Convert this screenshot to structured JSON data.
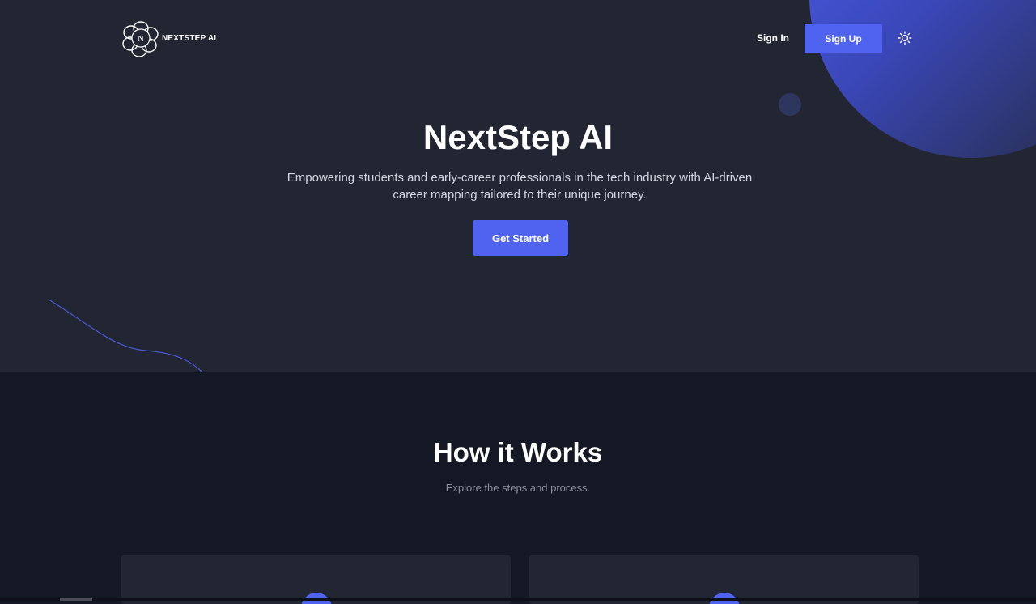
{
  "header": {
    "logo_text": "NEXTSTEP AI",
    "logo_letter": "N",
    "sign_in_label": "Sign In",
    "sign_up_label": "Sign Up",
    "theme_icon": "sun-icon"
  },
  "hero": {
    "title": "NextStep AI",
    "subtitle": "Empowering students and early-career professionals in the tech industry with AI-driven career mapping tailored to their unique journey.",
    "cta_label": "Get Started"
  },
  "how_it_works": {
    "title": "How it Works",
    "subtitle": "Explore the steps and process."
  },
  "colors": {
    "accent": "#5063f0",
    "hero_bg": "#222532",
    "section_bg": "#141824",
    "card_bg": "#222532",
    "text_primary": "#ffffff",
    "text_muted": "#8a8fa0"
  }
}
